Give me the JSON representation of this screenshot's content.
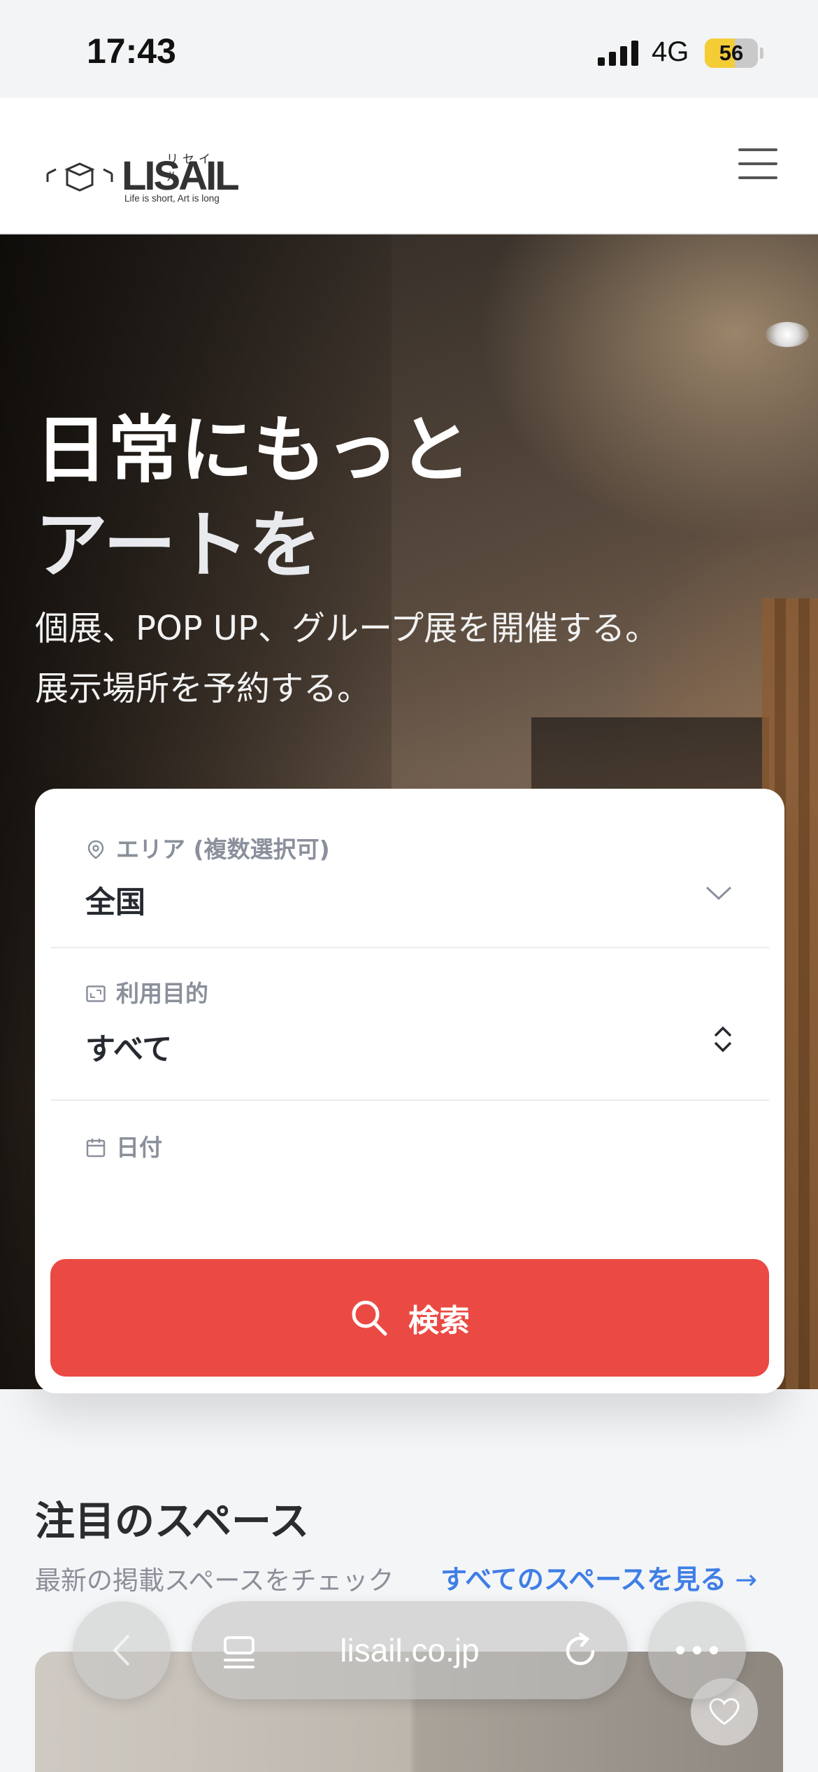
{
  "status_bar": {
    "time": "17:43",
    "network": "4G",
    "battery": "56",
    "battery_level": 0.56
  },
  "header": {
    "logo": {
      "wordmark": "LISAIL",
      "ruby": "リセイル",
      "tagline": "Life is short, Art is long"
    },
    "menu_icon": "hamburger-menu-icon"
  },
  "hero": {
    "title_line1": "日常にもっと",
    "title_line2": "アートを",
    "subtitle_line1": "個展、POP UP、グループ展を開催する。",
    "subtitle_line2": "展示場所を予約する。"
  },
  "search": {
    "area_label": "エリア (複数選択可)",
    "area_value": "全国",
    "purpose_label": "利用目的",
    "purpose_value": "すべて",
    "date_label": "日付",
    "date_value": "",
    "button_label": "検索",
    "accent_color": "#ea4a43"
  },
  "featured": {
    "title": "注目のスペース",
    "subtitle": "最新の掲載スペースをチェック",
    "see_all": "すべてのスペースを見る",
    "link_color": "#3f7ee6"
  },
  "browser": {
    "url": "lisail.co.jp"
  }
}
